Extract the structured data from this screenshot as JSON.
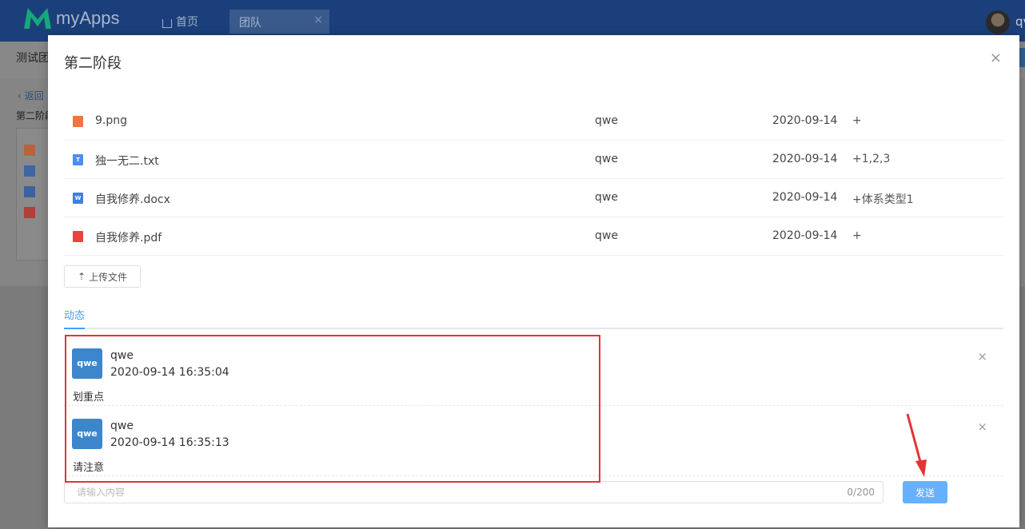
{
  "app": {
    "logo_text": "myApps",
    "user_name": "qv"
  },
  "nav": {
    "home_label": "首页",
    "tab_label": "团队",
    "tab_close": "×"
  },
  "background": {
    "title": "测试团",
    "back_label": "返回",
    "stage_label": "第二阶段"
  },
  "modal": {
    "title": "第二阶段",
    "close": "×",
    "files": [
      {
        "icon": "image-file-icon",
        "badge": "",
        "name": "9.png",
        "owner": "qwe",
        "date": "2020-09-14",
        "tag": "+"
      },
      {
        "icon": "text-file-icon",
        "badge": "T",
        "name": "独一无二.txt",
        "owner": "qwe",
        "date": "2020-09-14",
        "tag": "+1,2,3"
      },
      {
        "icon": "word-file-icon",
        "badge": "W",
        "name": "自我修养.docx",
        "owner": "qwe",
        "date": "2020-09-14",
        "tag": "+体系类型1"
      },
      {
        "icon": "pdf-file-icon",
        "badge": "",
        "name": "自我修养.pdf",
        "owner": "qwe",
        "date": "2020-09-14",
        "tag": "+"
      }
    ],
    "upload_label": "上传文件",
    "tab_active": "动态",
    "comments": [
      {
        "avatar": "qwe",
        "user": "qwe",
        "time": "2020-09-14 16:35:04",
        "text": "划重点",
        "delete": "×"
      },
      {
        "avatar": "qwe",
        "user": "qwe",
        "time": "2020-09-14 16:35:13",
        "text": "请注意",
        "delete": "×"
      }
    ],
    "input": {
      "placeholder": "请输入内容",
      "value": "",
      "counter": "0/200"
    },
    "send_label": "发送"
  },
  "colors": {
    "topbar": "#1b3f7a",
    "accent": "#409eff",
    "annotation": "#e53333"
  }
}
